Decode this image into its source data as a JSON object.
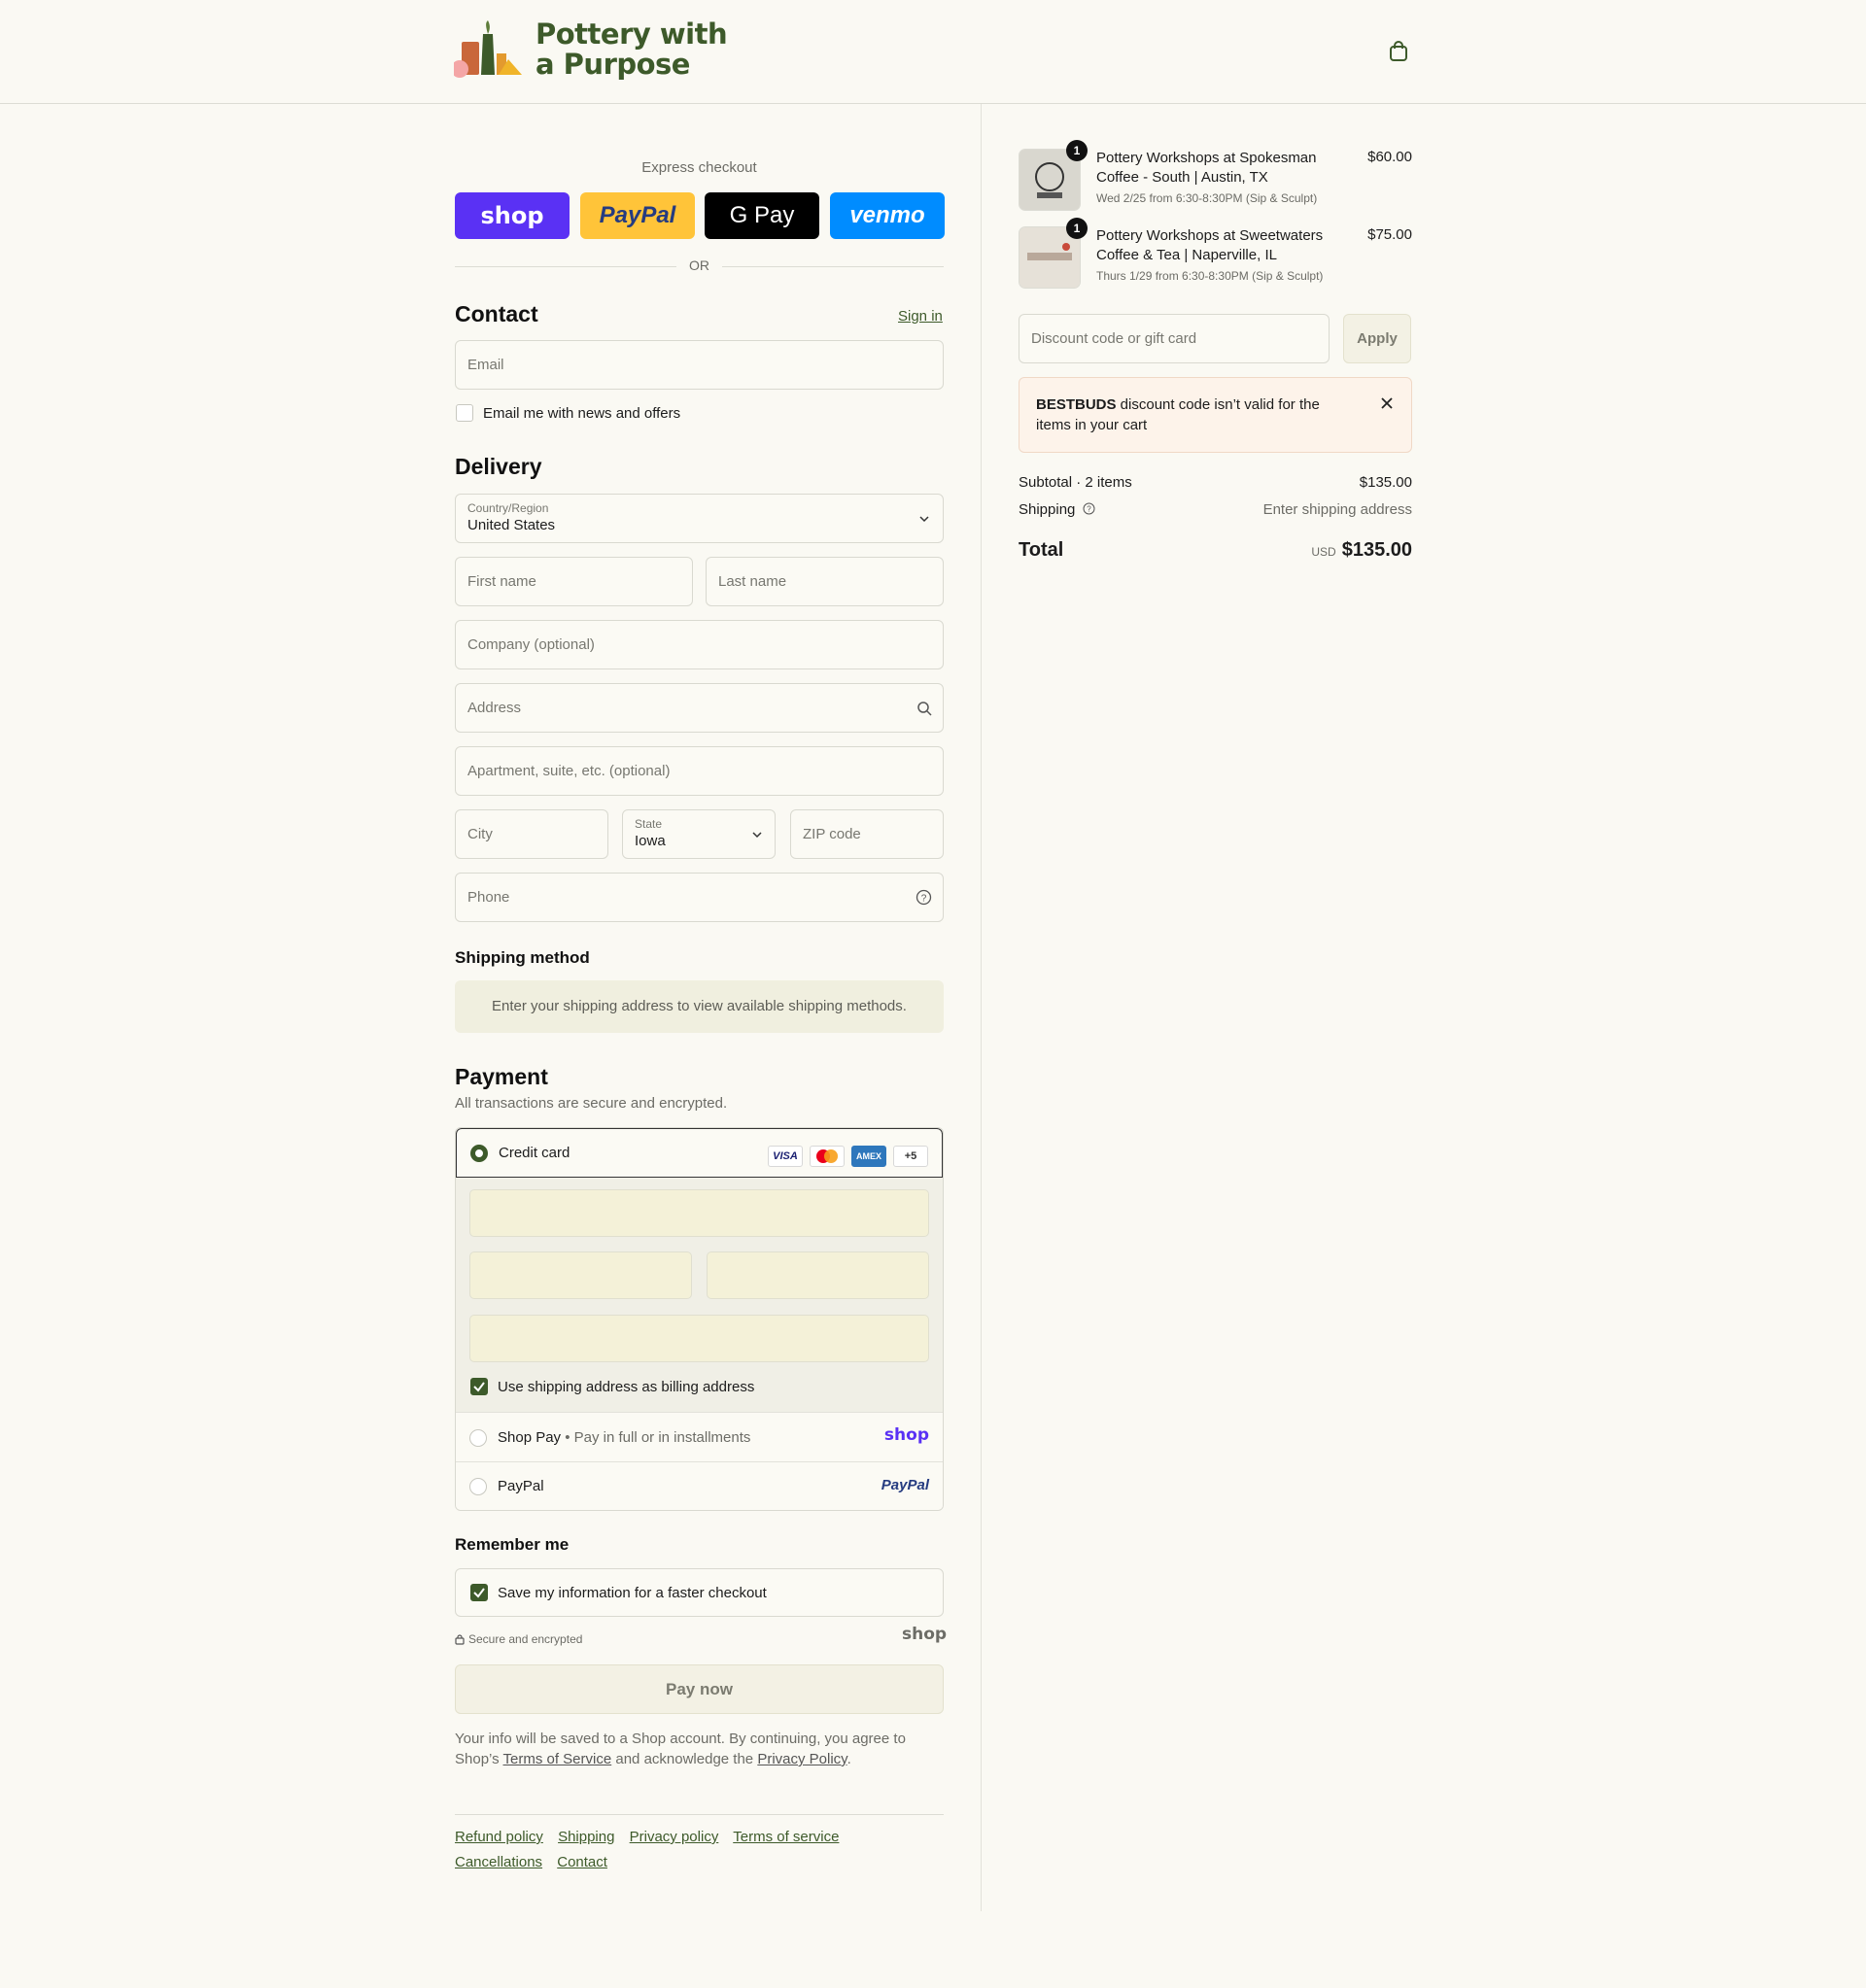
{
  "brand": {
    "name_line1": "Pottery with",
    "name_line2": "a Purpose",
    "color": "#3d5a2a"
  },
  "header": {
    "cart_icon": "shopping-bag-icon"
  },
  "express": {
    "label": "Express checkout",
    "buttons": [
      {
        "label": "shop",
        "bg": "#5a31f4"
      },
      {
        "label": "PayPal",
        "bg": "#ffc439"
      },
      {
        "label": "G Pay",
        "bg": "#000000"
      },
      {
        "label": "venmo",
        "bg": "#008cff"
      }
    ],
    "or": "OR"
  },
  "contact": {
    "title": "Contact",
    "sign_in": "Sign in",
    "email_placeholder": "Email",
    "newsletter_label": "Email me with news and offers"
  },
  "delivery": {
    "title": "Delivery",
    "country_label": "Country/Region",
    "country_value": "United States",
    "first_name": "First name",
    "last_name": "Last name",
    "company": "Company (optional)",
    "address": "Address",
    "apartment": "Apartment, suite, etc. (optional)",
    "city": "City",
    "state_label": "State",
    "state_value": "Iowa",
    "zip": "ZIP code",
    "phone": "Phone"
  },
  "shipping_method": {
    "title": "Shipping method",
    "note": "Enter your shipping address to view available shipping methods."
  },
  "payment": {
    "title": "Payment",
    "subtitle": "All transactions are secure and encrypted.",
    "credit_card_label": "Credit card",
    "cards": [
      "VISA",
      "Mastercard",
      "AMEX",
      "+5"
    ],
    "billing_label": "Use shipping address as billing address",
    "shop_pay_label": "Shop Pay",
    "shop_pay_sub": "Pay in full or in installments",
    "shop_pay_logo": "shop",
    "paypal_label": "PayPal",
    "paypal_logo": "PayPal"
  },
  "remember": {
    "title": "Remember me",
    "save_label": "Save my information for a faster checkout",
    "secure": "Secure and encrypted",
    "shop_logo": "shop"
  },
  "pay_now": "Pay now",
  "legal": {
    "text1": "Your info will be saved to a Shop account. By continuing, you agree to Shop’s ",
    "tos": "Terms of Service",
    "text2": " and acknowledge the ",
    "privacy": "Privacy Policy",
    "text3": "."
  },
  "footer": {
    "links_row1": [
      "Refund policy",
      "Shipping",
      "Privacy policy",
      "Terms of service"
    ],
    "links_row2": [
      "Cancellations",
      "Contact"
    ]
  },
  "cart": {
    "items": [
      {
        "qty": "1",
        "name": "Pottery Workshops at Spokesman Coffee - South | Austin, TX",
        "variant": "Wed 2/25 from 6:30-8:30PM (Sip & Sculpt)",
        "price": "$60.00"
      },
      {
        "qty": "1",
        "name": "Pottery Workshops at Sweetwaters Coffee & Tea | Naperville, IL",
        "variant": "Thurs 1/29 from 6:30-8:30PM (Sip & Sculpt)",
        "price": "$75.00"
      }
    ],
    "discount_placeholder": "Discount code or gift card",
    "apply": "Apply",
    "error_code": "BESTBUDS",
    "error_text": " discount code isn’t valid for the items in your cart",
    "subtotal_label": "Subtotal · 2 items",
    "subtotal_value": "$135.00",
    "shipping_label": "Shipping",
    "shipping_value": "Enter shipping address",
    "total_label": "Total",
    "currency": "USD",
    "total_value": "$135.00"
  }
}
